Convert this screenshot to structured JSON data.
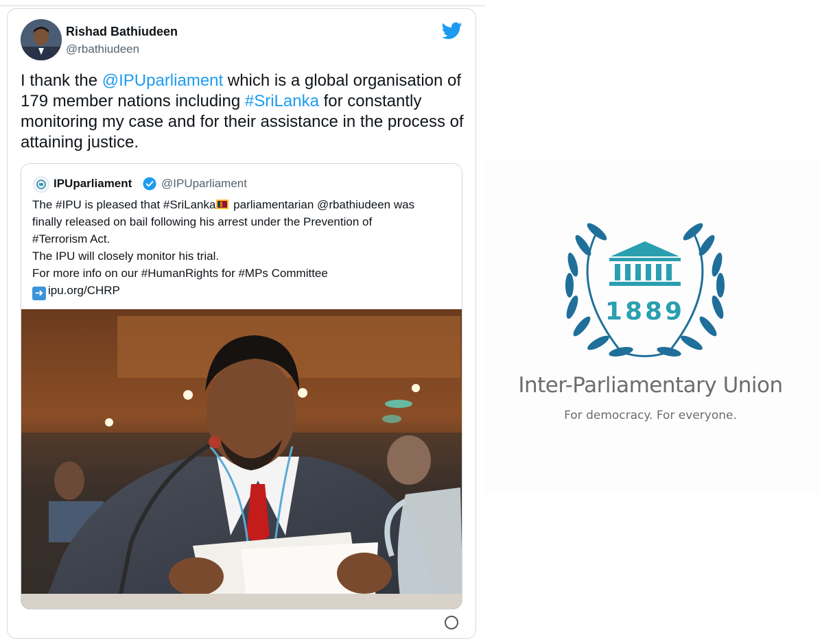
{
  "tweet": {
    "author_name": "Rishad Bathiudeen",
    "author_handle": "@rbathiudeen",
    "text_parts": [
      "I thank the ",
      "@IPUparliament",
      " which is a global organisation of 179 member nations including ",
      "#SriLanka",
      " for constantly monitoring my case and for their assistance in the process of attaining justice."
    ],
    "icon": "twitter-bird-icon",
    "accent_color": "#1d9bf0"
  },
  "quoted_tweet": {
    "author_name": "IPUparliament",
    "author_handle": "@IPUparliament",
    "verified_icon": "verified-badge-icon",
    "line1_before_flag": "The #IPU is pleased that #SriLanka",
    "line1_after_flag": " parliamentarian @rbathiudeen was",
    "line2": "finally released on bail following his arrest under the Prevention of",
    "line3": "#Terrorism Act.",
    "line4": "The IPU will closely monitor his trial.",
    "line5": "For more info on our #HumanRights for #MPs Committee",
    "link_icon": "right-arrow-icon",
    "link_text": "ipu.org/CHRP",
    "flag_icon": "sri-lanka-flag-icon"
  },
  "ipu_logo": {
    "year": "1889",
    "name": "Inter-Parliamentary Union",
    "tagline": "For democracy. For everyone.",
    "brand_color": "#1f6f9a",
    "teal_color": "#2a9fb0"
  }
}
